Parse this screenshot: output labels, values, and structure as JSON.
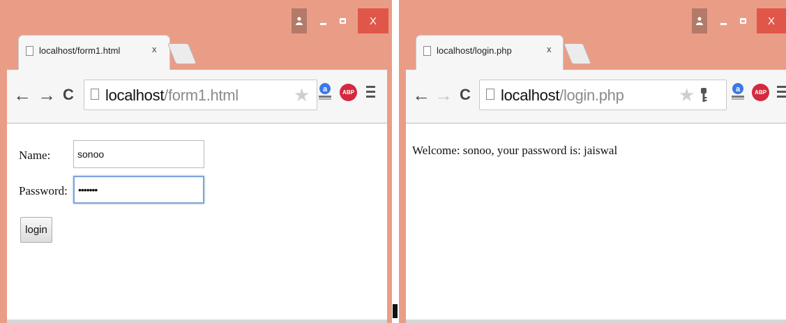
{
  "left_window": {
    "tab_title": "localhost/form1.html",
    "tab_close": "x",
    "url_host": "localhost",
    "url_path": "/form1.html",
    "close_label": "X",
    "form": {
      "name_label": "Name:",
      "name_value": "sonoo",
      "password_label": "Password:",
      "password_value": "•••••••",
      "login_button": "login"
    }
  },
  "right_window": {
    "tab_title": "localhost/login.php",
    "tab_close": "x",
    "url_host": "localhost",
    "url_path": "/login.php",
    "close_label": "X",
    "message": "Welcome: sonoo, your password is: jaiswal"
  },
  "toolbar": {
    "back": "←",
    "forward": "→",
    "reload": "C",
    "star": "★",
    "abp_label": "ABP"
  },
  "colors": {
    "frame": "#ea9d86",
    "close_button": "#e0574a",
    "abp_red": "#d4293e",
    "focus_border": "#7ea2dc"
  },
  "icons": [
    "user-icon",
    "minimize-icon",
    "maximize-icon",
    "close-icon",
    "page-icon",
    "back-arrow-icon",
    "forward-arrow-icon",
    "reload-icon",
    "star-icon",
    "key-icon",
    "ext-a-icon",
    "adblock-icon",
    "menu-icon"
  ]
}
